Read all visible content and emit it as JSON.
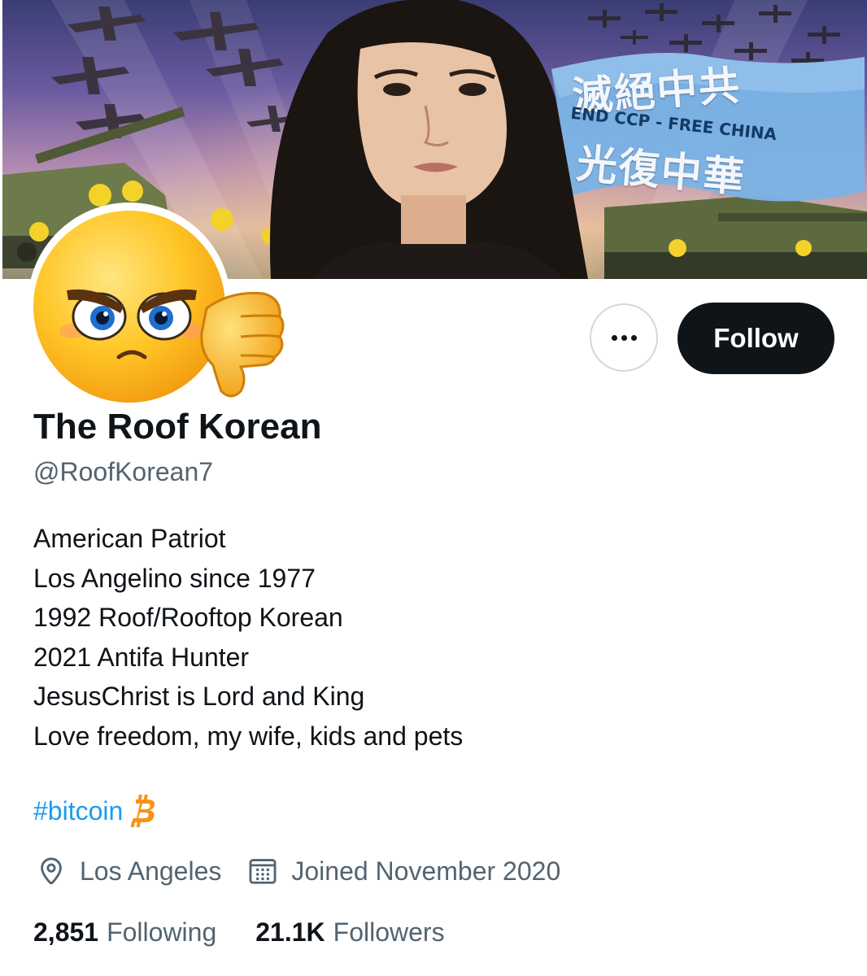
{
  "banner": {
    "flag_top_text": "滅絕中共",
    "flag_en_text": "END CCP - FREE CHINA",
    "flag_bottom_text": "光復中華"
  },
  "avatar": {
    "icon": "angry-thumbs-down-emoji"
  },
  "actions": {
    "more_icon": "ellipsis-icon",
    "follow_label": "Follow"
  },
  "profile": {
    "display_name": "The Roof Korean",
    "handle": "@RoofKorean7",
    "bio_lines": [
      "American Patriot",
      "Los Angelino since 1977",
      "1992 Roof/Rooftop Korean",
      "2021 Antifa Hunter",
      "JesusChrist is Lord and King",
      "Love freedom, my wife, kids and pets"
    ],
    "hashtag": "#bitcoin",
    "location": "Los Angeles",
    "joined": "Joined November 2020"
  },
  "stats": {
    "following_count": "2,851",
    "following_label": "Following",
    "followers_count": "21.1K",
    "followers_label": "Followers"
  },
  "colors": {
    "link": "#1d9bf0",
    "secondary_text": "#536471",
    "primary_text": "#0f1419",
    "bitcoin": "#f7931a"
  }
}
